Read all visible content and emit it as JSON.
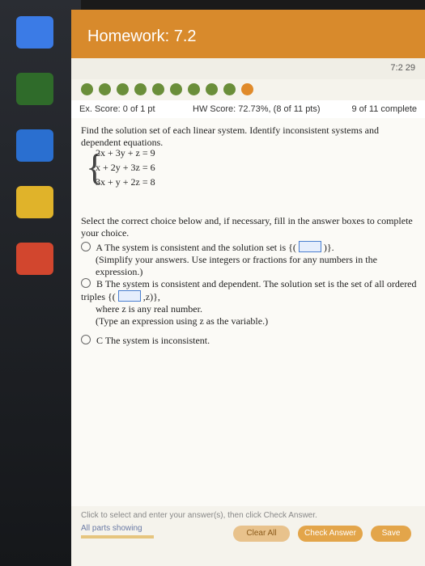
{
  "header": {
    "title": "Homework: 7.2",
    "due_time": "7:2 29"
  },
  "scores": {
    "ex_score": "Ex. Score: 0 of 1 pt",
    "hw_score": "HW Score: 72.73%, (8 of 11 pts)",
    "progress": "9 of 11 complete"
  },
  "question": {
    "prompt": "Find the solution set of each linear system. Identify inconsistent systems and dependent equations.",
    "equations": [
      "2x + 3y + z = 9",
      "x + 2y + 3z = 6",
      "3x + y + 2z = 8"
    ],
    "instruction": "Select the correct choice below and, if necessary, fill in the answer boxes to complete your choice.",
    "choices": [
      {
        "letter": "A",
        "text": "The system is consistent and the solution set is {(",
        "text2": ")}.",
        "note": "(Simplify your answers. Use integers or fractions for any numbers in the expression.)"
      },
      {
        "letter": "B",
        "text": "The system is consistent and dependent. The solution set is the set of all ordered triples {(",
        "text2": ",z)},",
        "note": "where z is any real number.",
        "note2": "(Type an expression using z as the variable.)"
      },
      {
        "letter": "C",
        "text": "The system is inconsistent."
      }
    ]
  },
  "footer": {
    "hint": "Click to select and enter your answer(s), then click Check Answer.",
    "parts": "All parts showing",
    "clear": "Clear All",
    "check": "Check Answer",
    "save": "Save"
  },
  "colors": {
    "accent": "#d88a2c",
    "dots": "#6a8e3a"
  }
}
